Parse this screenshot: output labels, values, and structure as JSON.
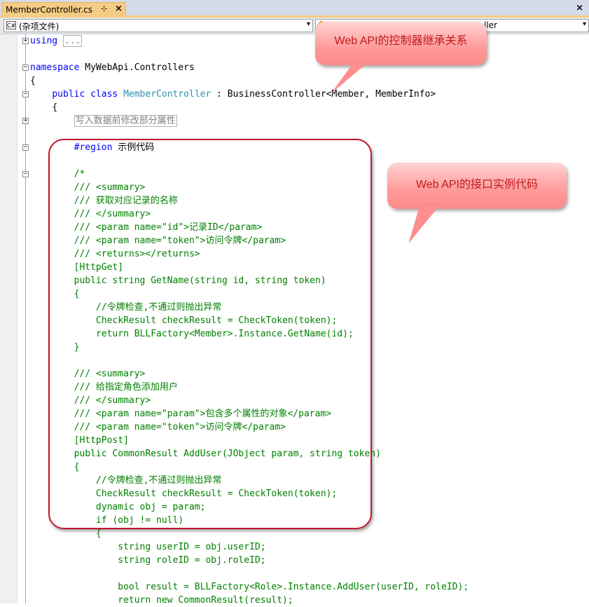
{
  "tab": {
    "title": "MemberController.cs",
    "pin": "⊹",
    "close": "×"
  },
  "window": {
    "close_all": "×"
  },
  "navbar": {
    "left_combo": {
      "icon": "C#",
      "value": "(杂项文件)"
    },
    "right_combo": {
      "value": "ller"
    }
  },
  "code": {
    "using_kw": "using",
    "using_collapsed": "...",
    "namespace_kw": "namespace",
    "namespace_name": " MyWebApi.Controllers",
    "open_brace": "{",
    "class_public": "public",
    "class_kw": "class",
    "class_name": "MemberController",
    "class_base": " : BusinessController<Member, MemberInfo>",
    "class_open": "{",
    "collapsed_region": "写入数据前修改部分属性",
    "region_kw": "#region",
    "region_name": " 示例代码",
    "comment_open": "/*",
    "m1_summary_open": "/// <summary>",
    "m1_summary_text": "/// 获取对应记录的名称",
    "m1_summary_close": "/// </summary>",
    "m1_param1": "/// <param name=\"id\">记录ID</param>",
    "m1_param2": "/// <param name=\"token\">访问令牌</param>",
    "m1_returns": "/// <returns></returns>",
    "m1_attr": "[HttpGet]",
    "m1_sig": "public string GetName(string id, string token)",
    "m1_open": "{",
    "m1_c1": "    //令牌检查,不通过则抛出异常",
    "m1_c2": "    CheckResult checkResult = CheckToken(token);",
    "m1_c3": "    return BLLFactory<Member>.Instance.GetName(id);",
    "m1_close": "}",
    "m2_summary_open": "/// <summary>",
    "m2_summary_text": "/// 给指定角色添加用户",
    "m2_summary_close": "/// </summary>",
    "m2_param1": "/// <param name=\"param\">包含多个属性的对象</param>",
    "m2_param2": "/// <param name=\"token\">访问令牌</param>",
    "m2_attr": "[HttpPost]",
    "m2_sig": "public CommonResult AddUser(JObject param, string token)",
    "m2_open": "{",
    "m2_c1": "    //令牌检查,不通过则抛出异常",
    "m2_c2": "    CheckResult checkResult = CheckToken(token);",
    "m2_c3": "    dynamic obj = param;",
    "m2_c4": "    if (obj != null)",
    "m2_c5": "    {",
    "m2_c6": "        string userID = obj.userID;",
    "m2_c7": "        string roleID = obj.roleID;",
    "m2_c8": "        bool result = BLLFactory<Role>.Instance.AddUser(userID, roleID);",
    "m2_c9": "        return new CommonResult(result);"
  },
  "annotations": {
    "callout_1": "Web API的控制器继承关系",
    "callout_2": "Web  API的接口实例代码",
    "box_color": "#c0152d",
    "callout_color": "#ff9a9a"
  },
  "colors": {
    "keyword": "#0000ff",
    "type": "#2b91af",
    "comment": "#008000",
    "tab_active": "#f5cc84"
  }
}
